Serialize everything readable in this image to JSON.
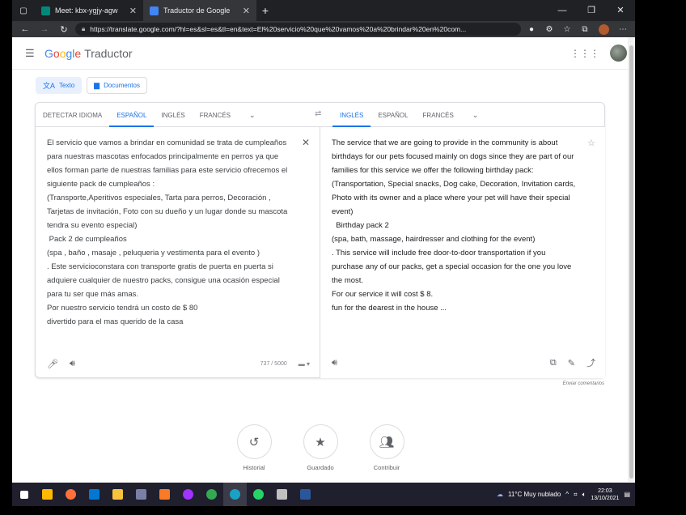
{
  "browser": {
    "tabs": [
      {
        "title": "Meet: kbx-ygjy-agw",
        "active": false
      },
      {
        "title": "Traductor de Google",
        "active": true
      }
    ],
    "url": "https://translate.google.com/?hl=es&sl=es&tl=en&text=El%20servicio%20que%20vamos%20a%20brindar%20en%20com..."
  },
  "header": {
    "logo_google": "Google",
    "logo_product": "Traductor"
  },
  "modes": [
    {
      "label": "Texto",
      "active": true
    },
    {
      "label": "Documentos",
      "active": false
    }
  ],
  "source": {
    "langs": [
      "DETECTAR IDIOMA",
      "ESPAÑOL",
      "INGLÉS",
      "FRANCÉS"
    ],
    "active_index": 1,
    "text": "El servicio que vamos a brindar en comunidad se trata de cumpleaños para nuestras mascotas enfocados principalmente en perros ya que ellos forman parte de nuestras familias para este servicio ofrecemos el siguiente pack de cumpleaños :\n(Transporte,Aperitivos especiales, Tarta para perros, Decoración , Tarjetas de invitación, Foto con su dueño y un lugar donde su mascota tendra su evento especial)\n Pack 2 de cumpleaños\n(spa , baño , masaje , peluqueria y vestimenta para el evento )\n. Este servicioconstara con transporte gratis de puerta en puerta si adquiere cualquier de nuestro packs, consigue una ocasión especial para tu ser que más amas.\nPor nuestro servicio tendrá un costo de $ 80\ndivertido para el mas querido de la casa",
    "char_count": "737 / 5000"
  },
  "target": {
    "langs": [
      "INGLÉS",
      "ESPAÑOL",
      "FRANCÉS"
    ],
    "active_index": 0,
    "text": "The service that we are going to provide in the community is about birthdays for our pets focused mainly on dogs since they are part of our families for this service we offer the following birthday pack:\n(Transportation, Special snacks, Dog cake, Decoration, Invitation cards, Photo with its owner and a place where your pet will have their special event)\n  Birthday pack 2\n(spa, bath, massage, hairdresser and clothing for the event)\n. This service will include free door-to-door transportation if you purchase any of our packs, get a special occasion for the one you love the most.\nFor our service it will cost $ 8.\nfun for the dearest in the house ..."
  },
  "feedback": "Enviar comentarios",
  "actions": [
    {
      "label": "Historial",
      "icon": "history-icon"
    },
    {
      "label": "Guardado",
      "icon": "star-icon"
    },
    {
      "label": "Contribuir",
      "icon": "contribute-icon"
    }
  ],
  "taskbar": {
    "weather": "11°C  Muy nublado",
    "time": "22:03",
    "date": "13/10/2021"
  }
}
